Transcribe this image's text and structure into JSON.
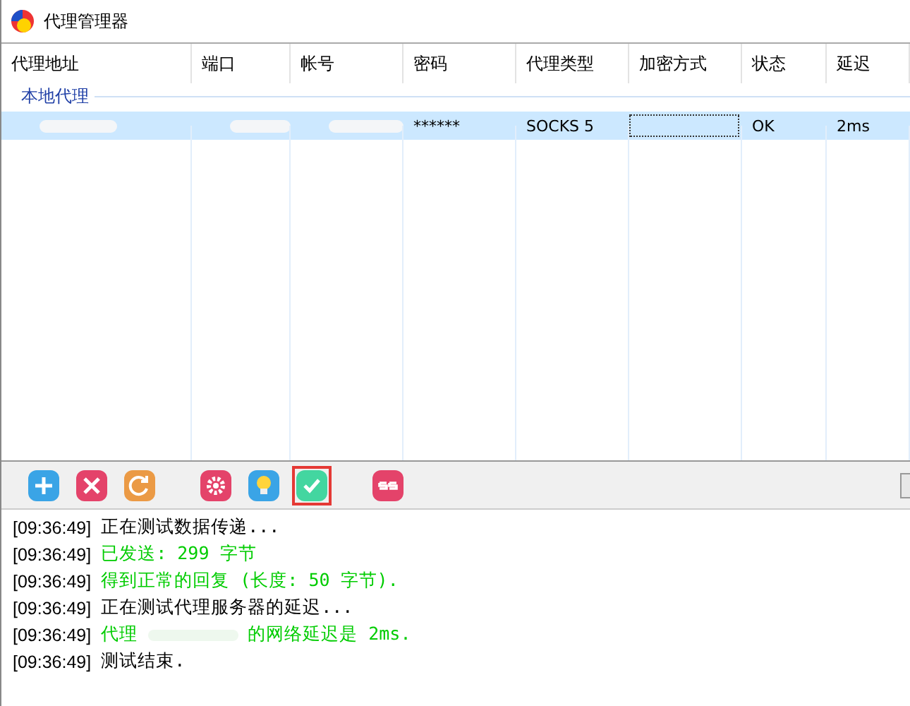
{
  "window": {
    "title": "代理管理器"
  },
  "table": {
    "columns": [
      "代理地址",
      "端口",
      "帐号",
      "密码",
      "代理类型",
      "加密方式",
      "状态",
      "延迟"
    ],
    "groups": [
      {
        "label": "本地代理",
        "rows": [
          {
            "selected": true,
            "cells": [
              {
                "kind": "redacted"
              },
              {
                "kind": "redacted"
              },
              {
                "kind": "redacted"
              },
              {
                "kind": "text",
                "text": "******"
              },
              {
                "kind": "text",
                "text": "SOCKS 5"
              },
              {
                "kind": "focus"
              },
              {
                "kind": "text",
                "text": "OK"
              },
              {
                "kind": "text",
                "text": "2ms"
              }
            ]
          }
        ]
      }
    ]
  },
  "toolbar": [
    {
      "kind": "add",
      "selected": false
    },
    {
      "kind": "delete",
      "selected": false
    },
    {
      "kind": "refresh",
      "selected": false
    },
    {
      "kind": "gap"
    },
    {
      "kind": "settings",
      "selected": false
    },
    {
      "kind": "bulb",
      "selected": false
    },
    {
      "kind": "check",
      "selected": true
    },
    {
      "kind": "gap"
    },
    {
      "kind": "ss",
      "selected": false
    }
  ],
  "log": [
    {
      "time": "[09:36:49]",
      "color": "#000000",
      "parts": [
        "正在测试数据传递..."
      ]
    },
    {
      "time": "[09:36:49]",
      "color": "#00cc00",
      "parts": [
        "已发送: 299 字节"
      ]
    },
    {
      "time": "[09:36:49]",
      "color": "#00cc00",
      "parts": [
        "得到正常的回复 (长度: 50 字节)."
      ]
    },
    {
      "time": "[09:36:49]",
      "color": "#000000",
      "parts": [
        "正在测试代理服务器的延迟..."
      ]
    },
    {
      "time": "[09:36:49]",
      "color": "#00cc00",
      "parts": [
        "代理",
        "的网络延迟是 2ms."
      ]
    },
    {
      "time": "[09:36:49]",
      "color": "#000000",
      "parts": [
        "测试结束."
      ]
    }
  ]
}
